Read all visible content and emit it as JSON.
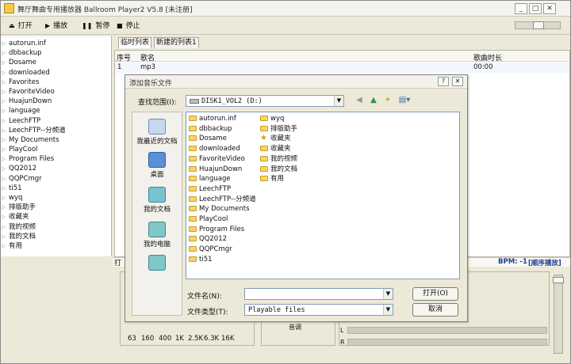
{
  "window": {
    "title": "舞厅舞曲专用播放器 Ballroom Player2 V5.8 [未注册]",
    "controls": [
      "_",
      "□",
      "✕"
    ]
  },
  "toolbar": {
    "open": "打开",
    "play": "播放",
    "pause": "暂停",
    "stop": "停止",
    "icons": [
      "eject-icon",
      "play-icon",
      "pause-icon",
      "stop-icon"
    ]
  },
  "tree": {
    "items": [
      "autorun.inf",
      "dbbackup",
      "Dosame",
      "downloaded",
      "Favorites",
      "FavoriteVideo",
      "HuajunDown",
      "language",
      "LeechFTP",
      "LeechFTP--分频道",
      "My Documents",
      "PlayCool",
      "Program Files",
      "QQ2012",
      "QQPCmgr",
      "ti51",
      "wyq",
      "排版助手",
      "收藏夹",
      "我的视频",
      "我的文档",
      "有用"
    ]
  },
  "playlist": {
    "tabs": [
      "临时列表",
      "新建的列表1"
    ],
    "columns": {
      "index": "序号",
      "name": "歌名",
      "duration": "歌曲时长"
    },
    "rows": [
      {
        "index": "1",
        "name": "mp3",
        "duration": "00:00"
      }
    ]
  },
  "status": {
    "play_text": "打",
    "bpm": "BPM: -1",
    "mode": "[顺序播放]"
  },
  "equalizer": {
    "bands": [
      "63",
      "160",
      "400",
      "1K",
      "2.5K",
      "6.3K",
      "16K"
    ],
    "volume_label": "音调"
  },
  "meters": {
    "left": "L",
    "right": "R"
  },
  "dialog": {
    "title": "添加音乐文件",
    "controls": [
      "?",
      "✕"
    ],
    "look_in_label": "查找范围(I):",
    "look_in_value": "DISK1_VOL2 (D:)",
    "places": [
      "我最近的文档",
      "桌面",
      "我的文档",
      "我的电脑",
      ""
    ],
    "folders_col1": [
      "autorun.inf",
      "dbbackup",
      "Dosame",
      "downloaded",
      "FavoriteVideo",
      "HuajunDown",
      "language",
      "LeechFTP",
      "LeechFTP--分频道",
      "My Documents",
      "PlayCool",
      "Program Files",
      "QQ2012",
      "QQPCmgr",
      "ti51"
    ],
    "folders_col2": [
      "wyq",
      "排版助手",
      "收藏夹",
      "收藏夹",
      "我的视频",
      "我的文档",
      "有用"
    ],
    "filename_label": "文件名(N):",
    "filename_value": "",
    "filetype_label": "文件类型(T):",
    "filetype_value": "Playable files",
    "open_button": "打开(O)",
    "cancel_button": "取消"
  },
  "colors": {
    "bpm_text": "#1f3f8f",
    "window_bg": "#ece9d8",
    "folder": "#f5d46a"
  }
}
